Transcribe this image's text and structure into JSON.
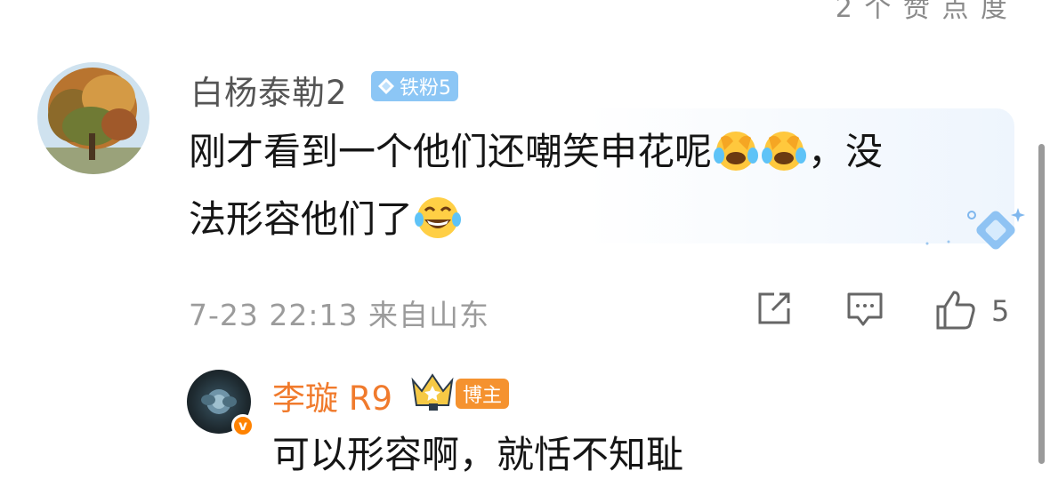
{
  "header": {
    "cut_text": "2 个 赞 点 度"
  },
  "comment": {
    "username": "白杨泰勒2",
    "fan_badge": "铁粉5",
    "text_line1": "刚才看到一个他们还嘲笑申花呢",
    "text_comma": "，没",
    "text_line2": "法形容他们了",
    "time": "7-23 22:13",
    "location": "来自山东",
    "like_count": "5"
  },
  "reply": {
    "username": "李璇 R9",
    "badge": "博主",
    "text": "可以形容啊，就恬不知耻"
  },
  "colors": {
    "accent_orange": "#f07a2c",
    "fan_badge_blue": "#8cc6f5",
    "meta_gray": "#9b9b9b"
  }
}
